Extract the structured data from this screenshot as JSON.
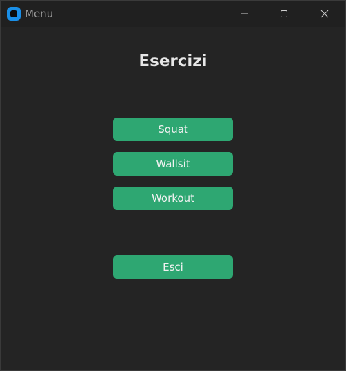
{
  "window": {
    "title": "Menu",
    "app_icon": "app-icon",
    "controls": [
      "minimize-icon",
      "maximize-icon",
      "close-icon"
    ]
  },
  "main": {
    "heading": "Esercizi",
    "buttons": {
      "squat": "Squat",
      "wallsit": "Wallsit",
      "workout": "Workout",
      "exit": "Esci"
    }
  },
  "colors": {
    "background": "#242424",
    "titlebar": "#202020",
    "button": "#2ea772",
    "accent_icon": "#1a8fe8"
  }
}
